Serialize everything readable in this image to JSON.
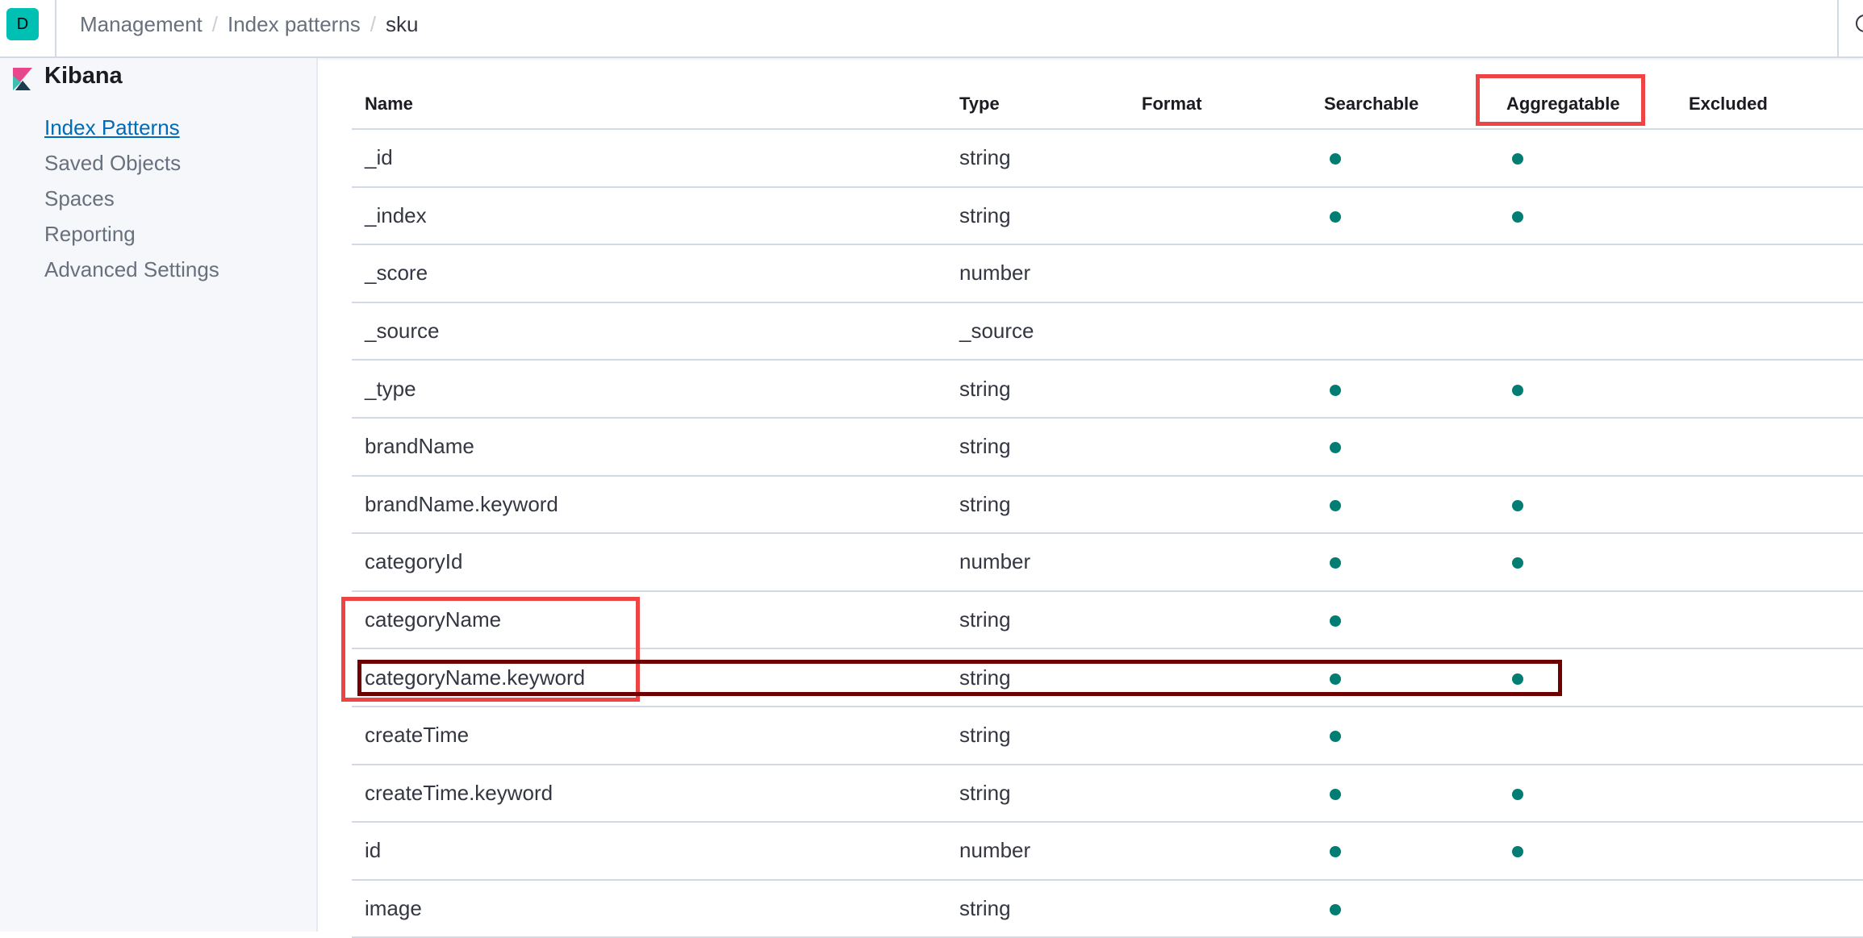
{
  "app": {
    "avatar_letter": "D",
    "product_name": "Kibana"
  },
  "breadcrumbs": [
    "Management",
    "Index patterns",
    "sku"
  ],
  "breadcrumb_separator": "/",
  "sidebar": {
    "items": [
      {
        "label": "Index Patterns",
        "active": true
      },
      {
        "label": "Saved Objects",
        "active": false
      },
      {
        "label": "Spaces",
        "active": false
      },
      {
        "label": "Reporting",
        "active": false
      },
      {
        "label": "Advanced Settings",
        "active": false
      }
    ]
  },
  "table": {
    "columns": [
      "Name",
      "Type",
      "Format",
      "Searchable",
      "Aggregatable",
      "Excluded"
    ],
    "rows": [
      {
        "name": "_id",
        "type": "string",
        "format": "",
        "searchable": true,
        "aggregatable": true,
        "excluded": false
      },
      {
        "name": "_index",
        "type": "string",
        "format": "",
        "searchable": true,
        "aggregatable": true,
        "excluded": false
      },
      {
        "name": "_score",
        "type": "number",
        "format": "",
        "searchable": false,
        "aggregatable": false,
        "excluded": false
      },
      {
        "name": "_source",
        "type": "_source",
        "format": "",
        "searchable": false,
        "aggregatable": false,
        "excluded": false
      },
      {
        "name": "_type",
        "type": "string",
        "format": "",
        "searchable": true,
        "aggregatable": true,
        "excluded": false
      },
      {
        "name": "brandName",
        "type": "string",
        "format": "",
        "searchable": true,
        "aggregatable": false,
        "excluded": false
      },
      {
        "name": "brandName.keyword",
        "type": "string",
        "format": "",
        "searchable": true,
        "aggregatable": true,
        "excluded": false
      },
      {
        "name": "categoryId",
        "type": "number",
        "format": "",
        "searchable": true,
        "aggregatable": true,
        "excluded": false
      },
      {
        "name": "categoryName",
        "type": "string",
        "format": "",
        "searchable": true,
        "aggregatable": false,
        "excluded": false
      },
      {
        "name": "categoryName.keyword",
        "type": "string",
        "format": "",
        "searchable": true,
        "aggregatable": true,
        "excluded": false
      },
      {
        "name": "createTime",
        "type": "string",
        "format": "",
        "searchable": true,
        "aggregatable": false,
        "excluded": false
      },
      {
        "name": "createTime.keyword",
        "type": "string",
        "format": "",
        "searchable": true,
        "aggregatable": true,
        "excluded": false
      },
      {
        "name": "id",
        "type": "number",
        "format": "",
        "searchable": true,
        "aggregatable": true,
        "excluded": false
      },
      {
        "name": "image",
        "type": "string",
        "format": "",
        "searchable": true,
        "aggregatable": false,
        "excluded": false
      }
    ]
  },
  "colors": {
    "accent": "#00bfb3",
    "link": "#006bb8",
    "dot": "#017d73",
    "highlight_red": "#ef4444",
    "highlight_dark": "#6f0000"
  }
}
